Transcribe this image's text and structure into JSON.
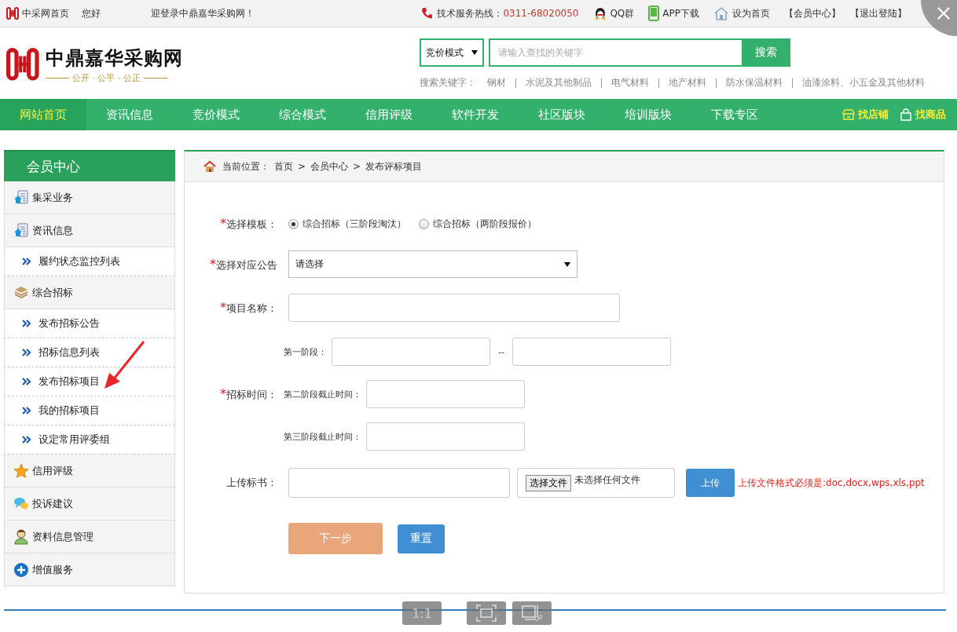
{
  "top_bar": {
    "home_link": "中采网首页",
    "greeting": "您好",
    "welcome": "迎登录中鼎嘉华采购网！",
    "hotline_label": "技术服务热线：",
    "hotline": "0311-68020050",
    "links": [
      {
        "kind": "qq",
        "label": "QQ群"
      },
      {
        "kind": "app",
        "label": "APP下载"
      },
      {
        "kind": "home",
        "label": "设为首页"
      },
      {
        "kind": "plain",
        "label": "【会员中心】"
      },
      {
        "kind": "plain",
        "label": "【退出登陆】"
      }
    ]
  },
  "header": {
    "logo_title": "中鼎嘉华采购网",
    "slogan": "公开 · 公平 · 公正",
    "search_mode": "竞价模式",
    "search_placeholder": "请输入查找的关键字",
    "search_button": "搜索",
    "keywords_label": "搜索关键字：",
    "keywords": [
      "钢材",
      "水泥及其他制品",
      "电气材料",
      "地产材料",
      "防水保温材料",
      "油漆涂料、小五金及其他材料"
    ]
  },
  "nav": {
    "items": [
      {
        "label": "网站首页",
        "selected": true
      },
      {
        "label": "资讯信息",
        "selected": false
      },
      {
        "label": "竞价模式",
        "selected": false
      },
      {
        "label": "综合模式",
        "selected": false
      },
      {
        "label": "信用评级",
        "selected": false
      },
      {
        "label": "软件开发",
        "selected": false
      },
      {
        "label": "社区版块",
        "selected": false
      },
      {
        "label": "培训版块",
        "selected": false
      },
      {
        "label": "下载专区",
        "selected": false
      }
    ],
    "right_links": [
      {
        "kind": "shop",
        "label": "找店铺"
      },
      {
        "kind": "goods",
        "label": "找商品"
      }
    ]
  },
  "sidebar": {
    "title": "会员中心",
    "items": [
      {
        "kind": "section",
        "label": "集采业务"
      },
      {
        "kind": "section",
        "label": "资讯信息"
      },
      {
        "kind": "link",
        "label": "履约状态监控列表"
      },
      {
        "kind": "section",
        "label": "综合招标"
      },
      {
        "kind": "link",
        "label": "发布招标公告"
      },
      {
        "kind": "link",
        "label": "招标信息列表"
      },
      {
        "kind": "link",
        "label": "发布招标项目"
      },
      {
        "kind": "link",
        "label": "我的招标项目"
      },
      {
        "kind": "link",
        "label": "设定常用评委组"
      },
      {
        "kind": "section",
        "label": "信用评级"
      },
      {
        "kind": "section",
        "label": "投诉建议"
      },
      {
        "kind": "section",
        "label": "资料信息管理"
      },
      {
        "kind": "section",
        "label": "增值服务"
      }
    ]
  },
  "breadcrumb": {
    "label": "当前位置：",
    "separator": ">",
    "crumbs": [
      "首页",
      "会员中心",
      "发布评标项目"
    ]
  },
  "form": {
    "template": {
      "required_mark": "*",
      "label": "选择模板：",
      "options": [
        {
          "label": "综合招标（三阶段淘汰）",
          "selected": true
        },
        {
          "label": "综合招标（两阶段报价）",
          "selected": false
        }
      ]
    },
    "notice": {
      "required_mark": "*",
      "label": "选择对应公告",
      "value": "请选择"
    },
    "project_name": {
      "required_mark": "*",
      "label": "项目名称："
    },
    "bid_time": {
      "required_mark": "*",
      "label": "招标时间：",
      "stage_one": "第一阶段：",
      "range_separator": "--",
      "stage_two": "第二阶段截止时间：",
      "stage_three": "第三阶段截止时间："
    },
    "upload": {
      "label": "上传标书：",
      "file_button": "选择文件",
      "file_status": "未选择任何文件",
      "upload_button": "上传",
      "hint": "上传文件格式必须是:doc,docx,wps,xls,ppt"
    },
    "next_button": "下一步",
    "reset_button": "重置"
  },
  "viewer_toolbar": {
    "actual_size": "1:1"
  }
}
